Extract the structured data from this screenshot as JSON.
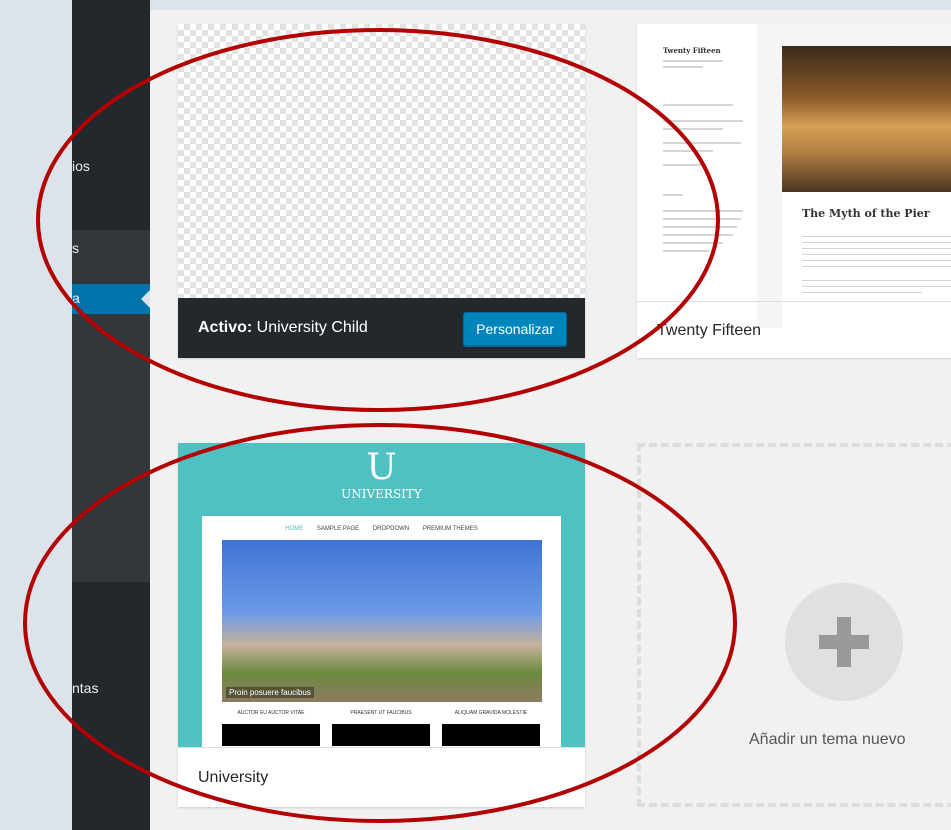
{
  "sidebar": {
    "items": [
      {
        "label": "ios"
      },
      {
        "label": "s"
      },
      {
        "label": "a"
      },
      {
        "label": "ntas"
      }
    ]
  },
  "themes": {
    "active": {
      "prefix": "Activo:",
      "name": "University Child",
      "customize_label": "Personalizar"
    },
    "twenty_fifteen": {
      "name": "Twenty Fifteen",
      "preview_site_title": "Twenty Fifteen",
      "preview_post_title": "The Myth of the Pier"
    },
    "university": {
      "name": "University",
      "preview_logo": "U",
      "preview_site_name": "UNIVERSITY",
      "preview_nav": [
        "HOME",
        "SAMPLE PAGE",
        "DROPDOWN",
        "PREMIUM THEMES"
      ],
      "preview_caption": "Proin posuere faucibus",
      "preview_columns": [
        "AUCTOR EU AUCTOR VITAE",
        "PRAESENT UT FAUCIBUS",
        "ALIQUAM GRAVIDA MOLESTIE"
      ]
    },
    "add_new": {
      "label": "Añadir un tema nuevo"
    }
  },
  "annotation": {
    "color": "#b30000"
  }
}
